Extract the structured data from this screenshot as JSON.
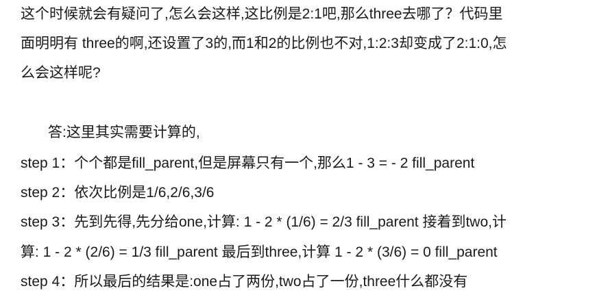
{
  "document": {
    "paragraph1": [
      "这个时候就会有疑问了,怎么会这样,这比例是2:1吧,那么three去哪了？代码里",
      "面明明有 three的啊,还设置了3的,而1和2的比例也不对,1:2:3却变成了2:1:0,怎",
      "么会这样呢?"
    ],
    "answer_intro": "答:这里其实需要计算的,",
    "steps": [
      "step 1：个个都是fill_parent,但是屏幕只有一个,那么1 - 3 = - 2 fill_parent",
      "step 2：依次比例是1/6,2/6,3/6",
      "step 3：先到先得,先分给one,计算: 1 - 2 * (1/6) = 2/3 fill_parent 接着到two,计",
      "算: 1 - 2 * (2/6) = 1/3 fill_parent 最后到three,计算 1 - 2 * (3/6) = 0 fill_parent",
      "step 4：所以最后的结果是:one占了两份,two占了一份,three什么都没有"
    ]
  }
}
